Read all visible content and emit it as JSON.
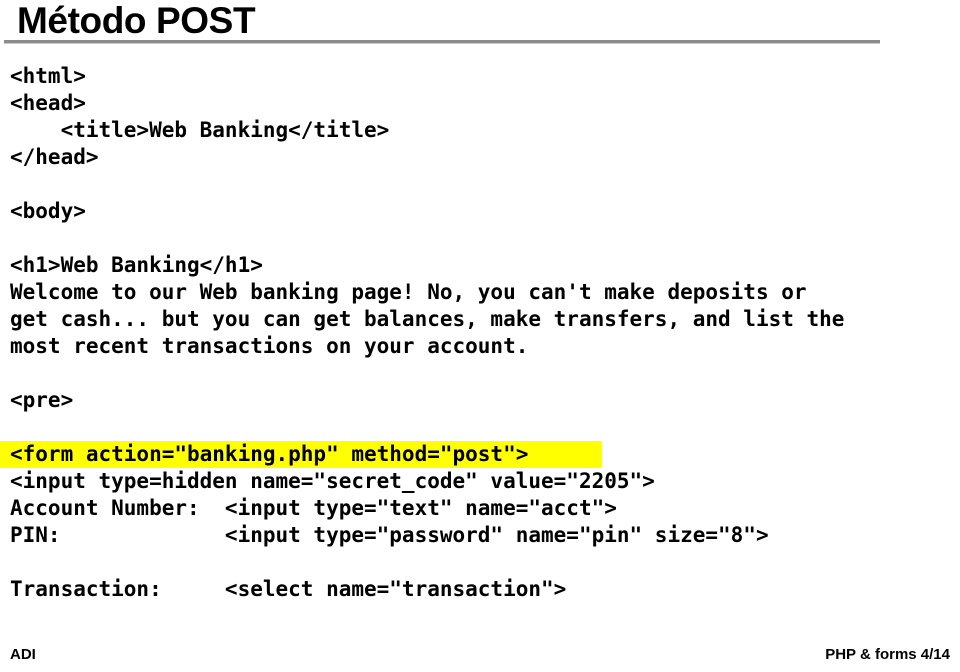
{
  "slide": {
    "title": "Método POST",
    "rule_color": "#8c8c8c",
    "highlight_color": "#ffff00",
    "background_color": "#ffffff",
    "text_color": "#000000"
  },
  "code": {
    "lines": [
      {
        "id": "l01",
        "text": "<html>",
        "highlight": false,
        "blank": false
      },
      {
        "id": "l02",
        "text": "<head>",
        "highlight": false,
        "blank": false
      },
      {
        "id": "l03",
        "text": "    <title>Web Banking</title>",
        "highlight": false,
        "blank": false
      },
      {
        "id": "l04",
        "text": "</head>",
        "highlight": false,
        "blank": false
      },
      {
        "id": "l05",
        "text": "",
        "highlight": false,
        "blank": true
      },
      {
        "id": "l06",
        "text": "<body>",
        "highlight": false,
        "blank": false
      },
      {
        "id": "l07",
        "text": "",
        "highlight": false,
        "blank": true
      },
      {
        "id": "l08",
        "text": "<h1>Web Banking</h1>",
        "highlight": false,
        "blank": false
      },
      {
        "id": "l09",
        "text": "Welcome to our Web banking page! No, you can't make deposits or",
        "highlight": false,
        "blank": false
      },
      {
        "id": "l10",
        "text": "get cash... but you can get balances, make transfers, and list the",
        "highlight": false,
        "blank": false
      },
      {
        "id": "l11",
        "text": "most recent transactions on your account.",
        "highlight": false,
        "blank": false
      },
      {
        "id": "l12",
        "text": "",
        "highlight": false,
        "blank": true
      },
      {
        "id": "l13",
        "text": "<pre>",
        "highlight": false,
        "blank": false
      },
      {
        "id": "l14",
        "text": "",
        "highlight": false,
        "blank": true
      },
      {
        "id": "l15",
        "text": "<form action=\"banking.php\" method=\"post\">",
        "highlight": true,
        "blank": false
      },
      {
        "id": "l16",
        "text": "<input type=hidden name=\"secret_code\" value=\"2205\">",
        "highlight": false,
        "blank": false
      },
      {
        "id": "l17",
        "text": "Account Number:  <input type=\"text\" name=\"acct\">",
        "highlight": false,
        "blank": false
      },
      {
        "id": "l18",
        "text": "PIN:             <input type=\"password\" name=\"pin\" size=\"8\">",
        "highlight": false,
        "blank": false
      },
      {
        "id": "l19",
        "text": "",
        "highlight": false,
        "blank": true
      },
      {
        "id": "l20",
        "text": "Transaction:     <select name=\"transaction\">",
        "highlight": false,
        "blank": false
      }
    ]
  },
  "footer": {
    "left": "ADI",
    "right": "PHP & forms 4/14"
  }
}
